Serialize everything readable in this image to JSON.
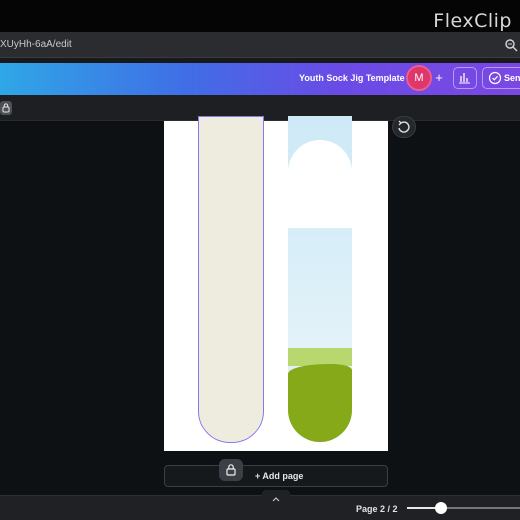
{
  "watermark": "FlexClip",
  "browser": {
    "url_fragment": "XUyHh-6aA/edit"
  },
  "app": {
    "design_title": "Youth Sock Jig Template",
    "avatar_initial": "M",
    "send_label": "Send"
  },
  "canvas": {
    "add_page_label": "+ Add page"
  },
  "footer": {
    "page_indicator": "Page 2 / 2",
    "zoom_fraction": 0.3
  },
  "colors": {
    "accent_purple": "#8b77e8",
    "avatar_pink": "#e0376a",
    "stick_cream": "#eeebdf",
    "grass_green": "#86a91a"
  },
  "icons": {
    "lock": "lock-icon",
    "zoom": "zoom-icon",
    "stats": "bar-chart-icon",
    "check": "check-circle-icon",
    "rotate": "rotate-icon",
    "chevron": "chevron-up-icon"
  }
}
